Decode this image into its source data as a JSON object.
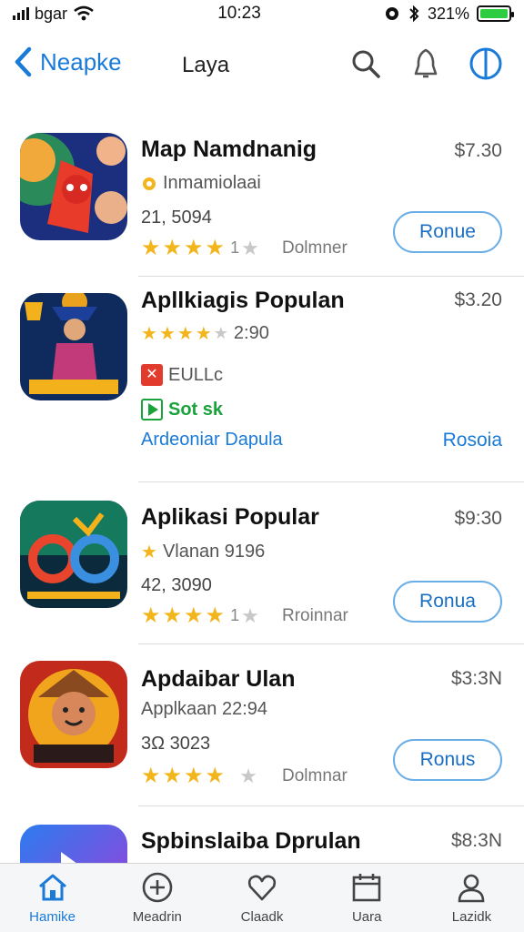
{
  "status": {
    "carrier": "bgar",
    "time": "10:23",
    "battery": "321%"
  },
  "nav": {
    "back_label": "Neapke",
    "title": "Laya"
  },
  "apps": [
    {
      "title": "Map Namdnanig",
      "price": "$7.30",
      "subtitle": "Inmamiolaai",
      "count": "21, 5094",
      "rating_count": "1",
      "author": "Dolmner",
      "button": "Ronue",
      "stars": 4,
      "theme": [
        "#1b2f7e",
        "#e83b2a"
      ]
    },
    {
      "title": "Apllkiagis Populan",
      "price": "$3.20",
      "rating_line": "2:90",
      "badge_red": "EULLc",
      "badge_green": "Sot  sk",
      "link_left": "Ardeoniar Dapula",
      "link_right": "Rosoia",
      "stars": 4,
      "theme": [
        "#0f2a5c",
        "#e9a21e"
      ]
    },
    {
      "title": "Aplikasi Popular",
      "price": "$9:30",
      "subtitle": "Vlanan 9196",
      "count": "42, 3090",
      "rating_count": "1",
      "author": "Rroinnar",
      "button": "Ronua",
      "stars": 4,
      "theme": [
        "#0b2a3c",
        "#f3b21b"
      ]
    },
    {
      "title": "Apdaibar Ulan",
      "price": "$3:3N",
      "subtitle": "Applkaan 22:94",
      "count": "3Ω 3023",
      "rating_count": "",
      "author": "Dolmnar",
      "button": "Ronus",
      "stars": 4,
      "theme": [
        "#c22a1b",
        "#f0a51c"
      ]
    },
    {
      "title": "Spbinslaiba Dprulan",
      "price": "$8:3N",
      "theme": [
        "#2d7cf0",
        "#a43ad6"
      ]
    }
  ],
  "tabs": [
    {
      "label": "Hamike",
      "icon": "home-icon",
      "active": true
    },
    {
      "label": "Meadrin",
      "icon": "plus-circle-icon",
      "active": false
    },
    {
      "label": "Claadk",
      "icon": "heart-icon",
      "active": false
    },
    {
      "label": "Uara",
      "icon": "calendar-icon",
      "active": false
    },
    {
      "label": "Lazidk",
      "icon": "person-icon",
      "active": false
    }
  ],
  "colors": {
    "accent": "#1a7ad8",
    "star": "#f2b51c",
    "battery": "#2ecc40"
  }
}
